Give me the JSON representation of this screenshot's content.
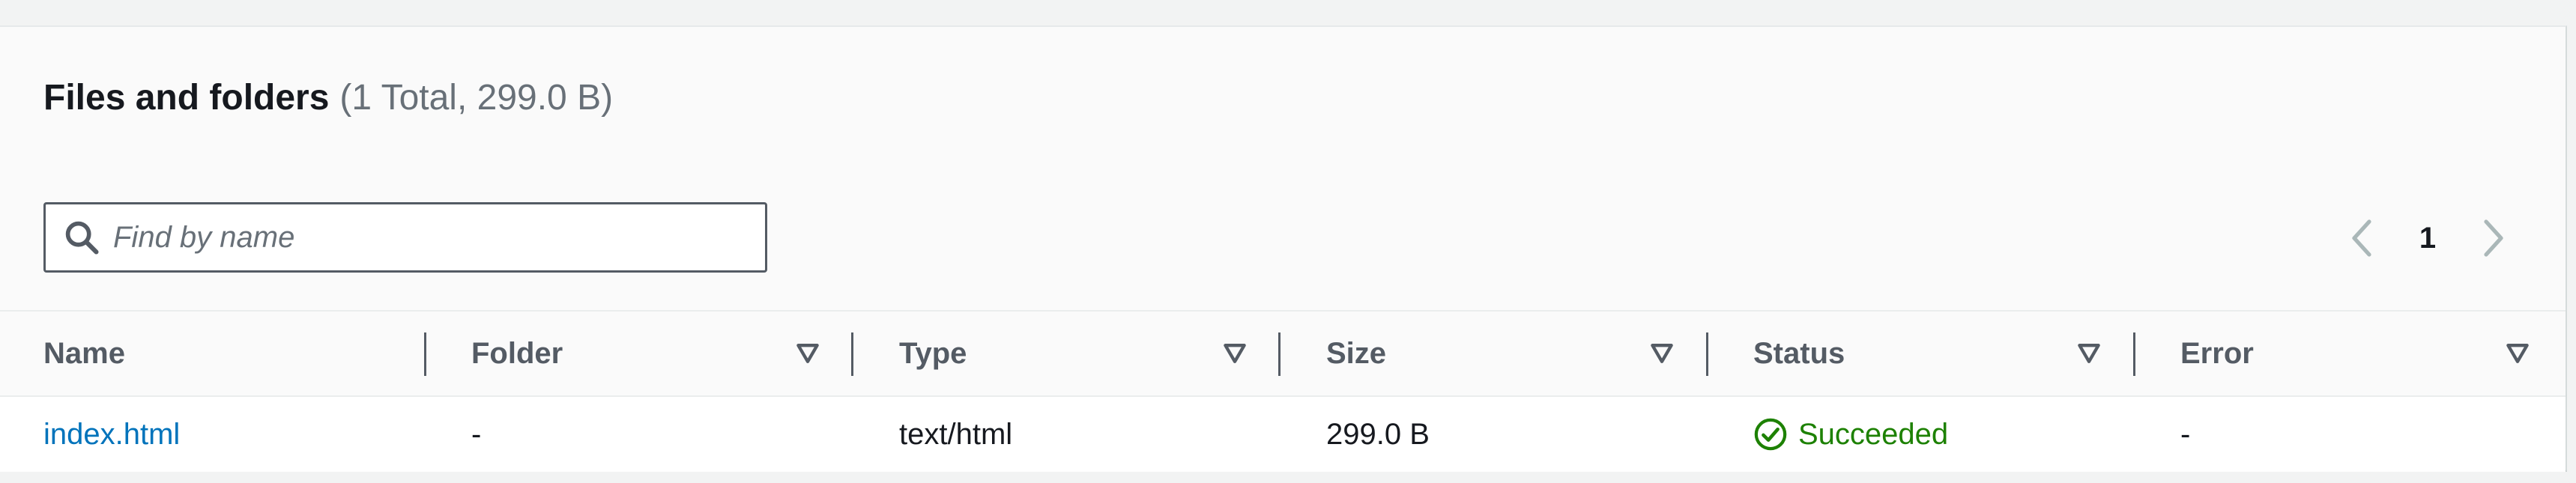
{
  "files_panel": {
    "title": "Files and folders",
    "counter": "(1 Total, 299.0 B)",
    "search": {
      "placeholder": "Find by name",
      "value": ""
    },
    "pagination": {
      "current_page": "1"
    },
    "columns": [
      {
        "label": "Name"
      },
      {
        "label": "Folder"
      },
      {
        "label": "Type"
      },
      {
        "label": "Size"
      },
      {
        "label": "Status"
      },
      {
        "label": "Error"
      }
    ],
    "rows": [
      {
        "name": "index.html",
        "folder": "-",
        "type": "text/html",
        "size": "299.0 B",
        "status": "Succeeded",
        "error": "-"
      }
    ]
  },
  "colors": {
    "link": "#0073bb",
    "success": "#1d8102",
    "header_text": "#545b64",
    "muted_text": "#687078"
  },
  "icons": {
    "search": "search-icon",
    "pager_prev": "chevron-left-icon",
    "pager_next": "chevron-right-icon",
    "sort": "sort-caret-down-icon",
    "status": "check-circle-icon"
  }
}
